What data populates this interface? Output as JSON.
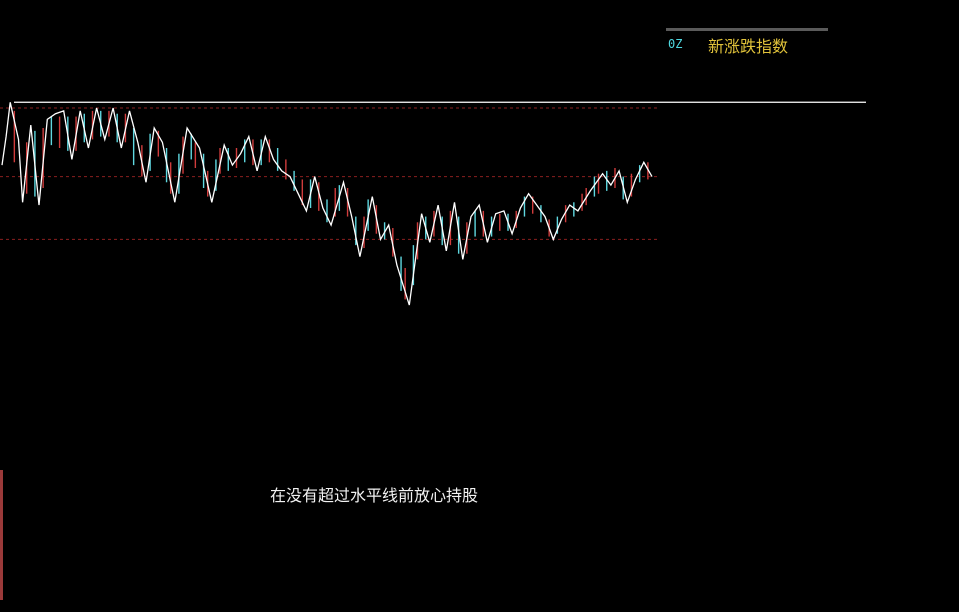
{
  "legend": {
    "code": "0Z",
    "title": "新涨跌指数"
  },
  "annotation": "在没有超过水平线前放心持股",
  "colors": {
    "background": "#000000",
    "up_bar": "#d03c3c",
    "down_bar": "#5fd8e0",
    "zigzag_line": "#ffffff",
    "reference_line": "#ffffff",
    "dashed_level": "#8a1f1f",
    "legend_title": "#e0c23a",
    "legend_code": "#4fd8e0"
  },
  "chart_data": {
    "type": "line",
    "grid": false,
    "legend_position": "top-right",
    "reference_line": 1.0,
    "dashed_levels": [
      0.98,
      0.74,
      0.52
    ],
    "ylim": [
      0,
      1.05
    ],
    "zigzag": [
      {
        "x": 0,
        "y": 0.78
      },
      {
        "x": 1,
        "y": 0.88
      },
      {
        "x": 2,
        "y": 1.0
      },
      {
        "x": 4,
        "y": 0.87
      },
      {
        "x": 5,
        "y": 0.65
      },
      {
        "x": 7,
        "y": 0.92
      },
      {
        "x": 9,
        "y": 0.64
      },
      {
        "x": 11,
        "y": 0.94
      },
      {
        "x": 13,
        "y": 0.96
      },
      {
        "x": 15,
        "y": 0.97
      },
      {
        "x": 17,
        "y": 0.8
      },
      {
        "x": 19,
        "y": 0.97
      },
      {
        "x": 21,
        "y": 0.84
      },
      {
        "x": 23,
        "y": 0.98
      },
      {
        "x": 25,
        "y": 0.87
      },
      {
        "x": 27,
        "y": 0.98
      },
      {
        "x": 29,
        "y": 0.84
      },
      {
        "x": 31,
        "y": 0.97
      },
      {
        "x": 33,
        "y": 0.86
      },
      {
        "x": 35,
        "y": 0.72
      },
      {
        "x": 37,
        "y": 0.91
      },
      {
        "x": 39,
        "y": 0.86
      },
      {
        "x": 42,
        "y": 0.65
      },
      {
        "x": 45,
        "y": 0.91
      },
      {
        "x": 48,
        "y": 0.84
      },
      {
        "x": 51,
        "y": 0.65
      },
      {
        "x": 54,
        "y": 0.85
      },
      {
        "x": 56,
        "y": 0.78
      },
      {
        "x": 58,
        "y": 0.82
      },
      {
        "x": 60,
        "y": 0.88
      },
      {
        "x": 62,
        "y": 0.76
      },
      {
        "x": 64,
        "y": 0.88
      },
      {
        "x": 66,
        "y": 0.8
      },
      {
        "x": 68,
        "y": 0.76
      },
      {
        "x": 70,
        "y": 0.74
      },
      {
        "x": 72,
        "y": 0.68
      },
      {
        "x": 74,
        "y": 0.62
      },
      {
        "x": 76,
        "y": 0.74
      },
      {
        "x": 78,
        "y": 0.63
      },
      {
        "x": 80,
        "y": 0.57
      },
      {
        "x": 83,
        "y": 0.72
      },
      {
        "x": 85,
        "y": 0.6
      },
      {
        "x": 87,
        "y": 0.46
      },
      {
        "x": 90,
        "y": 0.67
      },
      {
        "x": 92,
        "y": 0.52
      },
      {
        "x": 94,
        "y": 0.57
      },
      {
        "x": 96,
        "y": 0.43
      },
      {
        "x": 99,
        "y": 0.29
      },
      {
        "x": 102,
        "y": 0.61
      },
      {
        "x": 104,
        "y": 0.51
      },
      {
        "x": 106,
        "y": 0.64
      },
      {
        "x": 108,
        "y": 0.48
      },
      {
        "x": 110,
        "y": 0.65
      },
      {
        "x": 112,
        "y": 0.45
      },
      {
        "x": 114,
        "y": 0.6
      },
      {
        "x": 116,
        "y": 0.64
      },
      {
        "x": 118,
        "y": 0.51
      },
      {
        "x": 120,
        "y": 0.61
      },
      {
        "x": 122,
        "y": 0.62
      },
      {
        "x": 124,
        "y": 0.54
      },
      {
        "x": 126,
        "y": 0.63
      },
      {
        "x": 128,
        "y": 0.68
      },
      {
        "x": 130,
        "y": 0.64
      },
      {
        "x": 132,
        "y": 0.6
      },
      {
        "x": 134,
        "y": 0.52
      },
      {
        "x": 136,
        "y": 0.59
      },
      {
        "x": 138,
        "y": 0.64
      },
      {
        "x": 140,
        "y": 0.62
      },
      {
        "x": 143,
        "y": 0.69
      },
      {
        "x": 146,
        "y": 0.75
      },
      {
        "x": 148,
        "y": 0.71
      },
      {
        "x": 150,
        "y": 0.76
      },
      {
        "x": 152,
        "y": 0.65
      },
      {
        "x": 154,
        "y": 0.73
      },
      {
        "x": 156,
        "y": 0.79
      },
      {
        "x": 158,
        "y": 0.74
      }
    ],
    "bars": [
      {
        "x": 3,
        "low": 0.79,
        "high": 0.97,
        "dir": "up"
      },
      {
        "x": 6,
        "low": 0.68,
        "high": 0.86,
        "dir": "up"
      },
      {
        "x": 8,
        "low": 0.67,
        "high": 0.9,
        "dir": "down"
      },
      {
        "x": 10,
        "low": 0.7,
        "high": 0.91,
        "dir": "up"
      },
      {
        "x": 12,
        "low": 0.85,
        "high": 0.95,
        "dir": "down"
      },
      {
        "x": 14,
        "low": 0.84,
        "high": 0.95,
        "dir": "up"
      },
      {
        "x": 16,
        "low": 0.83,
        "high": 0.95,
        "dir": "down"
      },
      {
        "x": 18,
        "low": 0.83,
        "high": 0.95,
        "dir": "up"
      },
      {
        "x": 20,
        "low": 0.86,
        "high": 0.96,
        "dir": "down"
      },
      {
        "x": 22,
        "low": 0.87,
        "high": 0.97,
        "dir": "up"
      },
      {
        "x": 24,
        "low": 0.88,
        "high": 0.97,
        "dir": "down"
      },
      {
        "x": 26,
        "low": 0.88,
        "high": 0.97,
        "dir": "up"
      },
      {
        "x": 28,
        "low": 0.86,
        "high": 0.96,
        "dir": "down"
      },
      {
        "x": 30,
        "low": 0.86,
        "high": 0.96,
        "dir": "up"
      },
      {
        "x": 32,
        "low": 0.78,
        "high": 0.91,
        "dir": "down"
      },
      {
        "x": 34,
        "low": 0.74,
        "high": 0.85,
        "dir": "up"
      },
      {
        "x": 36,
        "low": 0.76,
        "high": 0.89,
        "dir": "down"
      },
      {
        "x": 38,
        "low": 0.81,
        "high": 0.9,
        "dir": "up"
      },
      {
        "x": 40,
        "low": 0.72,
        "high": 0.84,
        "dir": "down"
      },
      {
        "x": 41,
        "low": 0.68,
        "high": 0.79,
        "dir": "up"
      },
      {
        "x": 43,
        "low": 0.68,
        "high": 0.82,
        "dir": "down"
      },
      {
        "x": 44,
        "low": 0.75,
        "high": 0.88,
        "dir": "up"
      },
      {
        "x": 46,
        "low": 0.8,
        "high": 0.89,
        "dir": "down"
      },
      {
        "x": 47,
        "low": 0.77,
        "high": 0.86,
        "dir": "up"
      },
      {
        "x": 49,
        "low": 0.7,
        "high": 0.82,
        "dir": "down"
      },
      {
        "x": 50,
        "low": 0.67,
        "high": 0.76,
        "dir": "up"
      },
      {
        "x": 52,
        "low": 0.69,
        "high": 0.8,
        "dir": "down"
      },
      {
        "x": 53,
        "low": 0.75,
        "high": 0.84,
        "dir": "up"
      },
      {
        "x": 55,
        "low": 0.76,
        "high": 0.84,
        "dir": "down"
      },
      {
        "x": 57,
        "low": 0.77,
        "high": 0.84,
        "dir": "up"
      },
      {
        "x": 59,
        "low": 0.79,
        "high": 0.87,
        "dir": "down"
      },
      {
        "x": 61,
        "low": 0.78,
        "high": 0.87,
        "dir": "up"
      },
      {
        "x": 63,
        "low": 0.78,
        "high": 0.87,
        "dir": "down"
      },
      {
        "x": 65,
        "low": 0.79,
        "high": 0.87,
        "dir": "up"
      },
      {
        "x": 67,
        "low": 0.76,
        "high": 0.84,
        "dir": "down"
      },
      {
        "x": 69,
        "low": 0.73,
        "high": 0.8,
        "dir": "up"
      },
      {
        "x": 71,
        "low": 0.69,
        "high": 0.76,
        "dir": "down"
      },
      {
        "x": 73,
        "low": 0.64,
        "high": 0.73,
        "dir": "up"
      },
      {
        "x": 75,
        "low": 0.63,
        "high": 0.73,
        "dir": "down"
      },
      {
        "x": 77,
        "low": 0.62,
        "high": 0.72,
        "dir": "up"
      },
      {
        "x": 79,
        "low": 0.58,
        "high": 0.66,
        "dir": "down"
      },
      {
        "x": 81,
        "low": 0.6,
        "high": 0.7,
        "dir": "up"
      },
      {
        "x": 82,
        "low": 0.62,
        "high": 0.71,
        "dir": "down"
      },
      {
        "x": 84,
        "low": 0.6,
        "high": 0.7,
        "dir": "up"
      },
      {
        "x": 86,
        "low": 0.5,
        "high": 0.6,
        "dir": "down"
      },
      {
        "x": 88,
        "low": 0.49,
        "high": 0.6,
        "dir": "up"
      },
      {
        "x": 89,
        "low": 0.55,
        "high": 0.66,
        "dir": "down"
      },
      {
        "x": 91,
        "low": 0.54,
        "high": 0.64,
        "dir": "up"
      },
      {
        "x": 93,
        "low": 0.52,
        "high": 0.58,
        "dir": "down"
      },
      {
        "x": 95,
        "low": 0.46,
        "high": 0.56,
        "dir": "up"
      },
      {
        "x": 97,
        "low": 0.34,
        "high": 0.46,
        "dir": "down"
      },
      {
        "x": 98,
        "low": 0.31,
        "high": 0.42,
        "dir": "up"
      },
      {
        "x": 100,
        "low": 0.36,
        "high": 0.5,
        "dir": "down"
      },
      {
        "x": 101,
        "low": 0.45,
        "high": 0.58,
        "dir": "up"
      },
      {
        "x": 103,
        "low": 0.52,
        "high": 0.6,
        "dir": "down"
      },
      {
        "x": 105,
        "low": 0.53,
        "high": 0.62,
        "dir": "up"
      },
      {
        "x": 107,
        "low": 0.5,
        "high": 0.6,
        "dir": "down"
      },
      {
        "x": 109,
        "low": 0.5,
        "high": 0.62,
        "dir": "up"
      },
      {
        "x": 111,
        "low": 0.47,
        "high": 0.6,
        "dir": "down"
      },
      {
        "x": 113,
        "low": 0.47,
        "high": 0.58,
        "dir": "up"
      },
      {
        "x": 115,
        "low": 0.53,
        "high": 0.62,
        "dir": "down"
      },
      {
        "x": 117,
        "low": 0.53,
        "high": 0.62,
        "dir": "up"
      },
      {
        "x": 119,
        "low": 0.53,
        "high": 0.6,
        "dir": "down"
      },
      {
        "x": 121,
        "low": 0.55,
        "high": 0.61,
        "dir": "up"
      },
      {
        "x": 123,
        "low": 0.55,
        "high": 0.61,
        "dir": "down"
      },
      {
        "x": 125,
        "low": 0.56,
        "high": 0.62,
        "dir": "up"
      },
      {
        "x": 127,
        "low": 0.6,
        "high": 0.67,
        "dir": "down"
      },
      {
        "x": 129,
        "low": 0.61,
        "high": 0.67,
        "dir": "up"
      },
      {
        "x": 131,
        "low": 0.58,
        "high": 0.64,
        "dir": "down"
      },
      {
        "x": 133,
        "low": 0.53,
        "high": 0.59,
        "dir": "up"
      },
      {
        "x": 135,
        "low": 0.54,
        "high": 0.6,
        "dir": "down"
      },
      {
        "x": 137,
        "low": 0.58,
        "high": 0.64,
        "dir": "up"
      },
      {
        "x": 139,
        "low": 0.6,
        "high": 0.65,
        "dir": "down"
      },
      {
        "x": 141,
        "low": 0.62,
        "high": 0.68,
        "dir": "up"
      },
      {
        "x": 142,
        "low": 0.64,
        "high": 0.7,
        "dir": "up"
      },
      {
        "x": 144,
        "low": 0.67,
        "high": 0.74,
        "dir": "down"
      },
      {
        "x": 145,
        "low": 0.68,
        "high": 0.75,
        "dir": "up"
      },
      {
        "x": 147,
        "low": 0.69,
        "high": 0.76,
        "dir": "down"
      },
      {
        "x": 149,
        "low": 0.7,
        "high": 0.77,
        "dir": "up"
      },
      {
        "x": 151,
        "low": 0.66,
        "high": 0.74,
        "dir": "down"
      },
      {
        "x": 153,
        "low": 0.67,
        "high": 0.75,
        "dir": "up"
      },
      {
        "x": 155,
        "low": 0.72,
        "high": 0.78,
        "dir": "down"
      },
      {
        "x": 157,
        "low": 0.73,
        "high": 0.79,
        "dir": "up"
      }
    ]
  }
}
